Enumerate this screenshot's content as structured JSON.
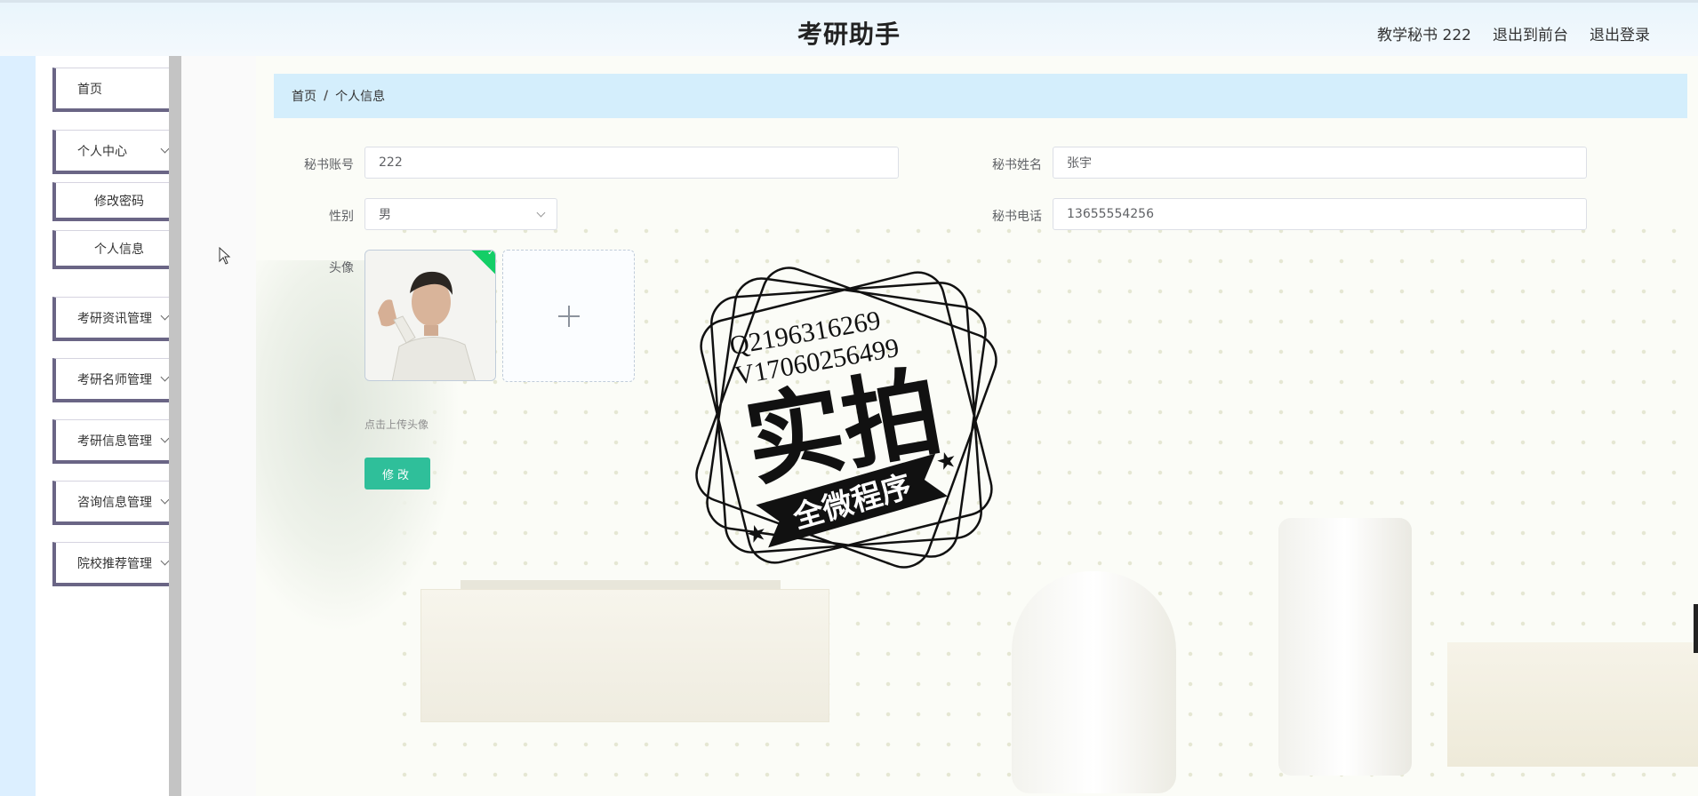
{
  "header": {
    "title": "考研助手",
    "user_label": "教学秘书 222",
    "to_frontend": "退出到前台",
    "logout": "退出登录"
  },
  "sidebar": {
    "items": [
      {
        "label": "首页"
      },
      {
        "label": "个人中心"
      },
      {
        "label": "修改密码"
      },
      {
        "label": "个人信息"
      },
      {
        "label": "考研资讯管理"
      },
      {
        "label": "考研名师管理"
      },
      {
        "label": "考研信息管理"
      },
      {
        "label": "咨询信息管理"
      },
      {
        "label": "院校推荐管理"
      }
    ]
  },
  "breadcrumb": {
    "home": "首页",
    "separator": "/",
    "current": "个人信息"
  },
  "form": {
    "account_label": "秘书账号",
    "account_value": "222",
    "name_label": "秘书姓名",
    "name_value": "张宇",
    "gender_label": "性别",
    "gender_value": "男",
    "phone_label": "秘书电话",
    "phone_value": "13655554256",
    "avatar_label": "头像",
    "upload_tip": "点击上传头像",
    "submit_label": "修改"
  },
  "watermark": {
    "line1": "Q2196316269",
    "line2": "V17060256499",
    "main": "实拍",
    "banner": "全微程序"
  },
  "colors": {
    "accent": "#2fbf9a",
    "breadcrumb_bg": "#d4eefc",
    "sidebar_border": "#6a6585",
    "success": "#13ce66"
  }
}
